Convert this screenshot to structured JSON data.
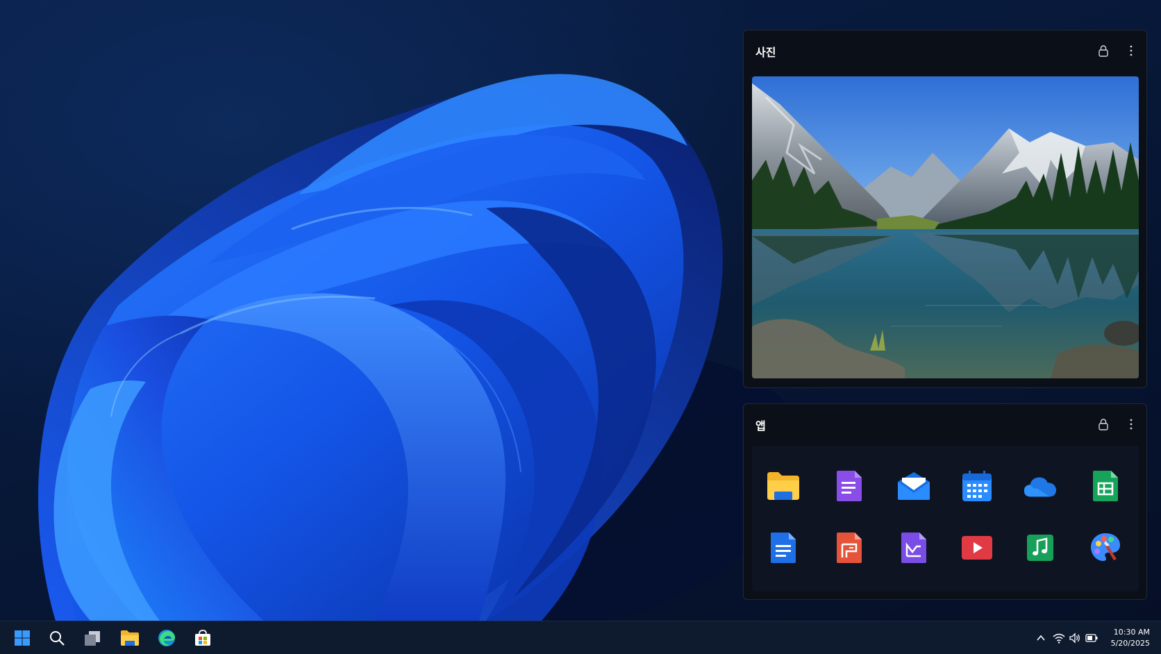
{
  "widgets": {
    "photos": {
      "title": "사진"
    },
    "apps": {
      "title": "앱"
    }
  },
  "apps": [
    {
      "name": "file-explorer",
      "icon": "folder-icon"
    },
    {
      "name": "notes",
      "icon": "notes-doc-icon"
    },
    {
      "name": "mail",
      "icon": "mail-icon"
    },
    {
      "name": "calendar",
      "icon": "calendar-icon"
    },
    {
      "name": "onedrive",
      "icon": "cloud-icon"
    },
    {
      "name": "sheets",
      "icon": "spreadsheet-icon"
    },
    {
      "name": "docs",
      "icon": "document-icon"
    },
    {
      "name": "slides",
      "icon": "presentation-icon"
    },
    {
      "name": "forms",
      "icon": "form-icon"
    },
    {
      "name": "video",
      "icon": "play-icon"
    },
    {
      "name": "music",
      "icon": "music-icon"
    },
    {
      "name": "paint",
      "icon": "palette-icon"
    }
  ],
  "taskbar": {
    "items": [
      "start-icon",
      "search-icon",
      "task-view-icon",
      "file-explorer-icon",
      "edge-icon",
      "store-icon"
    ],
    "tray": [
      "chevron-up-icon",
      "wifi-icon",
      "volume-icon",
      "battery-icon"
    ],
    "time": "10:30 AM",
    "date": "5/20/2025"
  },
  "colors": {
    "accent": "#1a6bff",
    "widget_bg": "#0b0f18",
    "taskbar_bg": "#0e1a2e"
  }
}
